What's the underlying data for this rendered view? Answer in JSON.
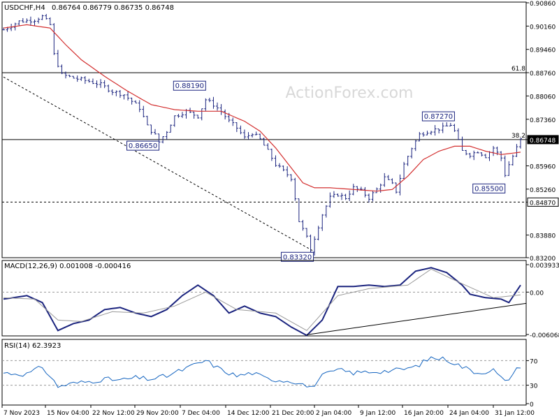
{
  "header": {
    "symbol": "USDCHF,H4",
    "ohlc": "0.86764 0.86779 0.86735 0.86748",
    "watermark": "ActionForex.com"
  },
  "chart_data": [
    {
      "type": "candlestick",
      "title": "USDCHF,H4",
      "ylim": [
        0.832,
        0.9086
      ],
      "y_ticks": [
        "0.90860",
        "0.90160",
        "0.89460",
        "0.88760",
        "0.88060",
        "0.87360",
        "0.86748",
        "0.85960",
        "0.85260",
        "0.84870",
        "0.83880",
        "0.83200"
      ],
      "x_ticks": [
        "7 Nov 2023",
        "15 Nov 04:00",
        "22 Nov 12:00",
        "29 Nov 20:00",
        "7 Dec 04:00",
        "14 Dec 12:00",
        "21 Dec 20:00",
        "2 Jan 04:00",
        "9 Jan 12:00",
        "16 Jan 20:00",
        "24 Jan 04:00",
        "31 Jan 12:00"
      ],
      "price_path": [
        [
          0,
          0.9005
        ],
        [
          4,
          0.903
        ],
        [
          8,
          0.9035
        ],
        [
          10,
          0.9045
        ],
        [
          12,
          0.902
        ],
        [
          13,
          0.893
        ],
        [
          15,
          0.887
        ],
        [
          18,
          0.886
        ],
        [
          22,
          0.885
        ],
        [
          25,
          0.884
        ],
        [
          28,
          0.882
        ],
        [
          31,
          0.881
        ],
        [
          35,
          0.877
        ],
        [
          37,
          0.8715
        ],
        [
          39,
          0.8688
        ],
        [
          40,
          0.8668
        ],
        [
          42,
          0.87
        ],
        [
          44,
          0.8745
        ],
        [
          47,
          0.876
        ],
        [
          50,
          0.8745
        ],
        [
          52,
          0.8795
        ],
        [
          54,
          0.878
        ],
        [
          56,
          0.876
        ],
        [
          58,
          0.873
        ],
        [
          60,
          0.871
        ],
        [
          62,
          0.868
        ],
        [
          64,
          0.8695
        ],
        [
          66,
          0.8675
        ],
        [
          68,
          0.864
        ],
        [
          70,
          0.86
        ],
        [
          72,
          0.858
        ],
        [
          74,
          0.856
        ],
        [
          75,
          0.85
        ],
        [
          76,
          0.843
        ],
        [
          78,
          0.838
        ],
        [
          79,
          0.834
        ],
        [
          80,
          0.838
        ],
        [
          82,
          0.845
        ],
        [
          84,
          0.85
        ],
        [
          86,
          0.851
        ],
        [
          88,
          0.85
        ],
        [
          90,
          0.853
        ],
        [
          92,
          0.852
        ],
        [
          94,
          0.85
        ],
        [
          96,
          0.8525
        ],
        [
          98,
          0.856
        ],
        [
          100,
          0.854
        ],
        [
          101,
          0.852
        ],
        [
          103,
          0.86
        ],
        [
          105,
          0.865
        ],
        [
          107,
          0.869
        ],
        [
          109,
          0.87
        ],
        [
          111,
          0.8705
        ],
        [
          113,
          0.871
        ],
        [
          115,
          0.872
        ],
        [
          116,
          0.87
        ],
        [
          118,
          0.864
        ],
        [
          120,
          0.863
        ],
        [
          122,
          0.864
        ],
        [
          124,
          0.8625
        ],
        [
          126,
          0.865
        ],
        [
          128,
          0.862
        ],
        [
          129,
          0.857
        ],
        [
          130,
          0.86
        ],
        [
          132,
          0.865
        ],
        [
          133,
          0.8675
        ]
      ],
      "sma_path": [
        [
          0,
          0.901
        ],
        [
          6,
          0.902
        ],
        [
          12,
          0.901
        ],
        [
          16,
          0.896
        ],
        [
          20,
          0.8915
        ],
        [
          26,
          0.8865
        ],
        [
          32,
          0.882
        ],
        [
          38,
          0.878
        ],
        [
          44,
          0.8765
        ],
        [
          50,
          0.876
        ],
        [
          56,
          0.876
        ],
        [
          62,
          0.873
        ],
        [
          66,
          0.87
        ],
        [
          70,
          0.865
        ],
        [
          74,
          0.859
        ],
        [
          77,
          0.8545
        ],
        [
          80,
          0.853
        ],
        [
          84,
          0.853
        ],
        [
          90,
          0.8525
        ],
        [
          96,
          0.852
        ],
        [
          100,
          0.8525
        ],
        [
          104,
          0.8565
        ],
        [
          108,
          0.8615
        ],
        [
          112,
          0.864
        ],
        [
          116,
          0.8655
        ],
        [
          120,
          0.8655
        ],
        [
          124,
          0.864
        ],
        [
          128,
          0.863
        ],
        [
          133,
          0.8637
        ]
      ],
      "levels": [
        {
          "name": "fib-61.8",
          "value": 0.8876,
          "label": "61.8",
          "style": "solid"
        },
        {
          "name": "fib-38.2",
          "value": 0.8675,
          "label": "38.2",
          "style": "solid"
        },
        {
          "name": "support-0.84870",
          "value": 0.8487,
          "label": "",
          "style": "dashed"
        }
      ],
      "annotations": [
        {
          "text": "0.88190",
          "x": 52,
          "y": 0.8819,
          "anchor": "right"
        },
        {
          "text": "0.86650",
          "x": 40,
          "y": 0.8665,
          "anchor": "right"
        },
        {
          "text": "0.87270",
          "x": 116,
          "y": 0.8727,
          "anchor": "right"
        },
        {
          "text": "0.85500",
          "x": 129,
          "y": 0.855,
          "anchor": "right"
        },
        {
          "text": "0.83320",
          "x": 79,
          "y": 0.8332,
          "anchor": "right"
        }
      ],
      "trendline": [
        [
          0,
          0.8863
        ],
        [
          80,
          0.8338
        ]
      ],
      "current_price": "0.86748",
      "support_price": "0.84870"
    },
    {
      "type": "line",
      "title": "MACD(12,26,9) 0.001008 -0.000416",
      "ylim": [
        -0.006068,
        0.003933
      ],
      "y_ticks": [
        "0.003933",
        "0.00",
        "-0.006068"
      ],
      "series": [
        {
          "name": "MACD",
          "points": [
            [
              0,
              -0.001
            ],
            [
              6,
              -0.0005
            ],
            [
              10,
              -0.0015
            ],
            [
              14,
              -0.0055
            ],
            [
              18,
              -0.0045
            ],
            [
              22,
              -0.004
            ],
            [
              26,
              -0.0025
            ],
            [
              30,
              -0.0022
            ],
            [
              34,
              -0.003
            ],
            [
              38,
              -0.0035
            ],
            [
              42,
              -0.0025
            ],
            [
              46,
              -0.0005
            ],
            [
              50,
              0.001
            ],
            [
              54,
              -0.0005
            ],
            [
              58,
              -0.003
            ],
            [
              62,
              -0.002
            ],
            [
              66,
              -0.003
            ],
            [
              70,
              -0.0035
            ],
            [
              74,
              -0.005
            ],
            [
              78,
              -0.0062
            ],
            [
              82,
              -0.004
            ],
            [
              86,
              0.0008
            ],
            [
              90,
              0.0008
            ],
            [
              94,
              0.001
            ],
            [
              98,
              0.0008
            ],
            [
              102,
              0.001
            ],
            [
              106,
              0.003
            ],
            [
              110,
              0.0035
            ],
            [
              114,
              0.0028
            ],
            [
              118,
              0.001
            ],
            [
              120,
              -0.0003
            ],
            [
              124,
              -0.0008
            ],
            [
              128,
              -0.001
            ],
            [
              130,
              -0.0015
            ],
            [
              133,
              0.001
            ]
          ]
        },
        {
          "name": "Signal",
          "points": [
            [
              0,
              -0.0008
            ],
            [
              8,
              -0.001
            ],
            [
              14,
              -0.004
            ],
            [
              20,
              -0.0042
            ],
            [
              28,
              -0.0028
            ],
            [
              36,
              -0.003
            ],
            [
              44,
              -0.002
            ],
            [
              52,
              0.0
            ],
            [
              60,
              -0.0025
            ],
            [
              70,
              -0.003
            ],
            [
              78,
              -0.0055
            ],
            [
              86,
              -0.0005
            ],
            [
              94,
              0.0005
            ],
            [
              104,
              0.001
            ],
            [
              110,
              0.0033
            ],
            [
              118,
              0.0012
            ],
            [
              126,
              -0.0008
            ],
            [
              133,
              -0.0004
            ]
          ]
        }
      ],
      "trendline": [
        [
          78,
          -0.0061
        ],
        [
          133,
          -0.0016
        ]
      ]
    },
    {
      "type": "line",
      "title": "RSI(14) 62.3923",
      "ylim": [
        0,
        100
      ],
      "y_ticks": [
        "70",
        "30",
        "0"
      ],
      "levels": [
        70,
        30
      ],
      "series": [
        {
          "name": "RSI",
          "points": [
            [
              0,
              50
            ],
            [
              6,
              48
            ],
            [
              10,
              60
            ],
            [
              14,
              28
            ],
            [
              18,
              33
            ],
            [
              22,
              36
            ],
            [
              26,
              40
            ],
            [
              30,
              38
            ],
            [
              34,
              42
            ],
            [
              38,
              40
            ],
            [
              42,
              45
            ],
            [
              46,
              55
            ],
            [
              52,
              70
            ],
            [
              56,
              55
            ],
            [
              60,
              45
            ],
            [
              64,
              50
            ],
            [
              68,
              40
            ],
            [
              72,
              38
            ],
            [
              76,
              35
            ],
            [
              79,
              25
            ],
            [
              82,
              45
            ],
            [
              86,
              55
            ],
            [
              90,
              50
            ],
            [
              94,
              52
            ],
            [
              98,
              53
            ],
            [
              102,
              55
            ],
            [
              106,
              60
            ],
            [
              110,
              75
            ],
            [
              114,
              72
            ],
            [
              118,
              60
            ],
            [
              122,
              50
            ],
            [
              126,
              55
            ],
            [
              129,
              35
            ],
            [
              133,
              62
            ]
          ]
        }
      ]
    }
  ]
}
